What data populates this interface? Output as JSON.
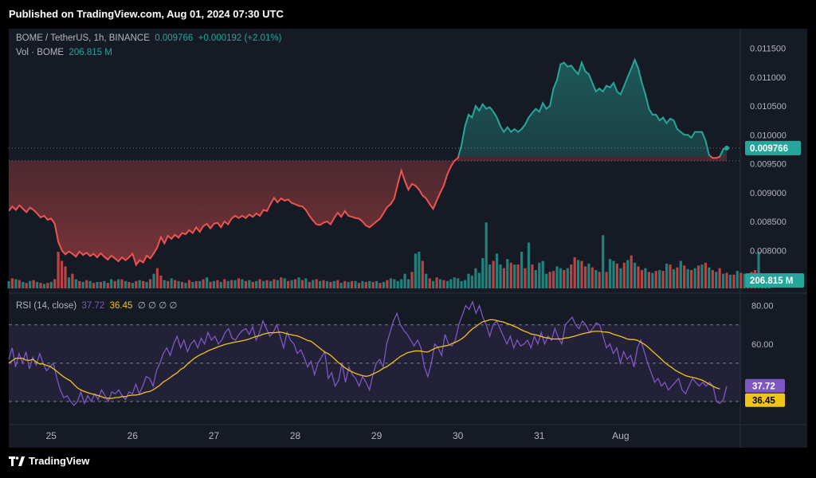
{
  "header": {
    "published": "Published on TradingView.com, Aug 01, 2024 07:30 UTC"
  },
  "legend": {
    "symbol": "BOME / TetherUS, 1h, BINANCE",
    "last": "0.009766",
    "change": "+0.000192 (+2.01%)",
    "vol_label": "Vol · BOME",
    "vol_value": "206.815 M",
    "rsi_label": "RSI (14, close)",
    "rsi_value": "37.72",
    "rsi_ma_value": "36.45",
    "rsi_extra": "∅ ∅ ∅ ∅"
  },
  "footer": {
    "brand": "TradingView"
  },
  "colors": {
    "up": "#26a69a",
    "down": "#ef5350",
    "rsi": "#7e57c2",
    "rsi_ma": "#f0c419",
    "panel_bg": "#161a25"
  },
  "chart_data": [
    {
      "type": "line",
      "title": "BOME / TetherUS, 1h, BINANCE",
      "baseline": 0.00955,
      "x_ticks": [
        "25",
        "26",
        "27",
        "28",
        "29",
        "30",
        "31",
        "Aug"
      ],
      "y_ticks": [
        "0.011500",
        "0.011000",
        "0.010500",
        "0.010000",
        "0.009500",
        "0.009000",
        "0.008500",
        "0.008000"
      ],
      "ylim": [
        0.0077,
        0.0117
      ],
      "last_price_label": "0.009766",
      "values": [
        0.00868,
        0.00876,
        0.0087,
        0.00878,
        0.00872,
        0.00866,
        0.00874,
        0.0087,
        0.00864,
        0.00857,
        0.0086,
        0.00853,
        0.00855,
        0.00846,
        0.00815,
        0.008,
        0.00793,
        0.00798,
        0.00794,
        0.00789,
        0.00798,
        0.00792,
        0.00796,
        0.0079,
        0.00794,
        0.00788,
        0.00795,
        0.00789,
        0.00784,
        0.00791,
        0.00786,
        0.00781,
        0.00788,
        0.00783,
        0.00788,
        0.00794,
        0.00775,
        0.00783,
        0.00779,
        0.00791,
        0.00786,
        0.00795,
        0.00805,
        0.00823,
        0.00812,
        0.00825,
        0.0082,
        0.00827,
        0.00822,
        0.0083,
        0.00828,
        0.00835,
        0.0083,
        0.0084,
        0.00832,
        0.00842,
        0.00846,
        0.00838,
        0.00846,
        0.00848,
        0.0084,
        0.0085,
        0.00845,
        0.00855,
        0.0086,
        0.00856,
        0.0086,
        0.00856,
        0.00862,
        0.00858,
        0.00864,
        0.0086,
        0.0087,
        0.00868,
        0.0088,
        0.00891,
        0.00883,
        0.0089,
        0.00886,
        0.00888,
        0.00882,
        0.0088,
        0.00877,
        0.00876,
        0.0087,
        0.0086,
        0.00852,
        0.00845,
        0.00844,
        0.00848,
        0.0085,
        0.00845,
        0.00856,
        0.00865,
        0.00858,
        0.00868,
        0.0086,
        0.00858,
        0.00856,
        0.00855,
        0.0085,
        0.00843,
        0.0084,
        0.00845,
        0.0085,
        0.00855,
        0.00865,
        0.00875,
        0.0088,
        0.0089,
        0.00915,
        0.00938,
        0.0092,
        0.00905,
        0.00915,
        0.00912,
        0.00905,
        0.00895,
        0.0089,
        0.0088,
        0.00872,
        0.00886,
        0.009,
        0.00912,
        0.00932,
        0.00945,
        0.00955,
        0.0096,
        0.00982,
        0.01015,
        0.01035,
        0.0103,
        0.0105,
        0.01042,
        0.01053,
        0.01045,
        0.01048,
        0.0104,
        0.0103,
        0.01015,
        0.01005,
        0.01013,
        0.01005,
        0.0101,
        0.01005,
        0.0101,
        0.01018,
        0.0103,
        0.01038,
        0.01045,
        0.0104,
        0.01055,
        0.01045,
        0.0105,
        0.0108,
        0.01095,
        0.01122,
        0.01125,
        0.01118,
        0.0112,
        0.01112,
        0.01105,
        0.01125,
        0.0111,
        0.01105,
        0.0109,
        0.01075,
        0.0108,
        0.01075,
        0.01085,
        0.01082,
        0.0109,
        0.01075,
        0.0107,
        0.01085,
        0.011,
        0.01115,
        0.0113,
        0.01115,
        0.0109,
        0.0107,
        0.01045,
        0.01035,
        0.01035,
        0.01025,
        0.0103,
        0.0102,
        0.01028,
        0.01025,
        0.0101,
        0.01005,
        0.01,
        0.01,
        0.00995,
        0.01005,
        0.01005,
        0.01005,
        0.0099,
        0.00965,
        0.0096,
        0.0096,
        0.00962,
        0.00975,
        0.00977
      ]
    },
    {
      "type": "bar",
      "title": "Vol · BOME",
      "last_value_label": "206.815 M",
      "values": [
        8,
        11,
        10,
        9,
        7,
        6,
        8,
        9,
        7,
        6,
        5,
        6,
        7,
        10,
        40,
        30,
        24,
        12,
        16,
        10,
        8,
        7,
        9,
        8,
        6,
        7,
        7,
        8,
        6,
        10,
        8,
        10,
        10,
        8,
        7,
        6,
        8,
        9,
        8,
        7,
        10,
        16,
        22,
        14,
        9,
        8,
        11,
        9,
        8,
        7,
        6,
        9,
        7,
        8,
        8,
        10,
        12,
        7,
        8,
        9,
        7,
        10,
        8,
        9,
        9,
        11,
        10,
        8,
        9,
        7,
        8,
        10,
        8,
        9,
        8,
        10,
        9,
        12,
        11,
        8,
        9,
        10,
        12,
        9,
        11,
        7,
        9,
        10,
        8,
        9,
        8,
        7,
        8,
        9,
        6,
        8,
        7,
        8,
        8,
        6,
        8,
        7,
        8,
        7,
        8,
        6,
        7,
        9,
        11,
        10,
        8,
        10,
        16,
        10,
        18,
        38,
        40,
        30,
        16,
        11,
        8,
        12,
        10,
        9,
        8,
        10,
        12,
        11,
        8,
        9,
        16,
        14,
        22,
        17,
        33,
        72,
        26,
        30,
        38,
        26,
        22,
        32,
        28,
        26,
        26,
        40,
        22,
        50,
        26,
        20,
        28,
        30,
        16,
        18,
        19,
        24,
        22,
        20,
        22,
        26,
        34,
        31,
        30,
        24,
        27,
        23,
        20,
        18,
        58,
        18,
        32,
        30,
        27,
        22,
        28,
        31,
        36,
        28,
        24,
        20,
        22,
        18,
        17,
        19,
        20,
        19,
        27,
        26,
        21,
        23,
        30,
        25,
        21,
        20,
        22,
        25,
        26,
        28,
        23,
        20,
        18,
        22,
        16,
        17,
        15,
        15,
        19,
        17,
        16,
        14,
        18,
        20,
        40,
        16,
        15,
        10
      ],
      "up": [
        true,
        false,
        true,
        false,
        true,
        false,
        true,
        false,
        true,
        false,
        true,
        false,
        true,
        false,
        false,
        false,
        false,
        true,
        false,
        true,
        false,
        true,
        false,
        true,
        false,
        true,
        false,
        true,
        false,
        true,
        false,
        true,
        false,
        true,
        false,
        true,
        false,
        true,
        false,
        true,
        false,
        true,
        false,
        false,
        true,
        false,
        true,
        false,
        true,
        false,
        true,
        false,
        true,
        false,
        true,
        false,
        true,
        false,
        true,
        false,
        true,
        false,
        true,
        false,
        true,
        false,
        true,
        false,
        true,
        false,
        true,
        false,
        true,
        false,
        true,
        false,
        true,
        false,
        true,
        false,
        true,
        false,
        true,
        false,
        true,
        false,
        true,
        false,
        true,
        false,
        true,
        false,
        true,
        false,
        true,
        false,
        true,
        false,
        true,
        false,
        true,
        false,
        true,
        false,
        true,
        false,
        true,
        false,
        true,
        true,
        true,
        true,
        true,
        true,
        false,
        true,
        true,
        false,
        true,
        false,
        true,
        false,
        true,
        false,
        true,
        true,
        true,
        true,
        true,
        true,
        true,
        true,
        true,
        true,
        true,
        true,
        true,
        false,
        true,
        true,
        false,
        true,
        false,
        true,
        false,
        true,
        false,
        true,
        false,
        true,
        true,
        true,
        true,
        false,
        false,
        true,
        true,
        false,
        true,
        false,
        false,
        true,
        false,
        false,
        true,
        false,
        true,
        false,
        true,
        false,
        true,
        true,
        false,
        true,
        false,
        true,
        false,
        true,
        false,
        false,
        true,
        false,
        true,
        false,
        true,
        false,
        true,
        false,
        true,
        false,
        true,
        false,
        true,
        false,
        true,
        false,
        true,
        false,
        true,
        false,
        true,
        false,
        true,
        false,
        true,
        false,
        true,
        false,
        true,
        false,
        false,
        false,
        true,
        false,
        true,
        true,
        true,
        true,
        true,
        false,
        true,
        true
      ],
      "ylim": [
        0,
        80
      ]
    },
    {
      "type": "line",
      "title": "RSI (14, close)",
      "y_ticks": [
        "80.00",
        "60.00"
      ],
      "ylim": [
        20,
        84
      ],
      "bands": [
        70,
        50,
        30
      ],
      "series": [
        {
          "name": "RSI",
          "last_label": "37.72",
          "values": [
            52,
            58,
            48,
            55,
            50,
            56,
            47,
            53,
            49,
            55,
            50,
            46,
            48,
            50,
            42,
            36,
            32,
            33,
            30,
            28,
            30,
            35,
            29,
            33,
            30,
            34,
            31,
            36,
            33,
            30,
            35,
            34,
            36,
            33,
            31,
            35,
            34,
            39,
            34,
            38,
            43,
            42,
            38,
            46,
            50,
            55,
            58,
            54,
            60,
            64,
            58,
            62,
            56,
            60,
            62,
            58,
            63,
            60,
            66,
            62,
            64,
            60,
            62,
            66,
            68,
            63,
            62,
            65,
            67,
            68,
            65,
            69,
            62,
            66,
            72,
            68,
            64,
            66,
            70,
            64,
            58,
            66,
            62,
            60,
            55,
            57,
            53,
            48,
            51,
            44,
            50,
            53,
            56,
            42,
            45,
            38,
            41,
            50,
            40,
            48,
            44,
            42,
            38,
            43,
            40,
            36,
            44,
            50,
            52,
            48,
            60,
            66,
            72,
            76,
            70,
            67,
            65,
            62,
            59,
            62,
            58,
            48,
            43,
            50,
            60,
            58,
            54,
            65,
            60,
            59,
            62,
            70,
            75,
            80,
            78,
            82,
            76,
            80,
            74,
            70,
            64,
            70,
            72,
            68,
            64,
            60,
            64,
            58,
            62,
            59,
            60,
            62,
            58,
            64,
            60,
            66,
            60,
            64,
            62,
            68,
            63,
            60,
            70,
            72,
            74,
            70,
            68,
            72,
            70,
            66,
            68,
            71,
            70,
            64,
            58,
            60,
            55,
            58,
            50,
            56,
            52,
            54,
            48,
            58,
            62,
            56,
            50,
            45,
            40,
            42,
            38,
            40,
            36,
            38,
            40,
            42,
            36,
            34,
            38,
            42,
            40,
            38,
            40,
            38,
            40,
            38,
            30,
            29,
            31,
            38
          ]
        },
        {
          "name": "MA",
          "last_label": "36.45",
          "values": [
            50.0,
            51.2,
            52.5,
            52.6,
            52.5,
            51.6,
            51.4,
            52.0,
            50.6,
            49.6,
            49.6,
            48.8,
            48.3,
            47.1,
            45.7,
            44.2,
            42.8,
            41.7,
            40.7,
            38.8,
            37.1,
            36.0,
            35.2,
            34.6,
            34.0,
            33.6,
            33.1,
            32.5,
            31.8,
            31.7,
            31.6,
            32.0,
            32.1,
            32.6,
            32.5,
            33.1,
            33.3,
            33.4,
            33.6,
            34.3,
            34.9,
            35.2,
            36.1,
            37.3,
            38.5,
            40.2,
            41.2,
            42.5,
            43.8,
            44.9,
            46.7,
            47.7,
            49.5,
            51.0,
            52.5,
            53.6,
            54.6,
            55.4,
            56.4,
            57.1,
            57.8,
            58.6,
            59.2,
            59.8,
            60.2,
            60.6,
            61.0,
            61.3,
            61.7,
            62.1,
            62.6,
            63.3,
            63.9,
            64.3,
            65.1,
            65.5,
            65.9,
            65.9,
            66.0,
            66.2,
            65.8,
            65.3,
            64.9,
            64.5,
            64.2,
            63.5,
            62.7,
            61.8,
            61.4,
            60.0,
            58.6,
            57.2,
            55.7,
            54.9,
            53.6,
            51.9,
            50.2,
            48.9,
            47.4,
            46.3,
            45.4,
            44.6,
            44.0,
            43.5,
            43.1,
            43.5,
            44.3,
            45.1,
            46.1,
            47.3,
            48.1,
            49.4,
            50.7,
            52.1,
            53.5,
            54.4,
            55.4,
            55.8,
            56.3,
            56.4,
            56.3,
            55.9,
            55.8,
            56.8,
            57.6,
            58.3,
            58.6,
            59.0,
            59.3,
            60.2,
            60.9,
            61.8,
            62.9,
            64.4,
            66.3,
            67.9,
            69.1,
            70.5,
            71.6,
            72.0,
            72.6,
            72.6,
            72.3,
            71.8,
            71.4,
            70.7,
            70.1,
            69.3,
            68.6,
            67.6,
            66.7,
            66.1,
            65.2,
            64.9,
            64.5,
            63.9,
            63.4,
            63.1,
            62.6,
            62.6,
            62.6,
            62.6,
            63.1,
            63.3,
            63.7,
            64.2,
            64.8,
            65.3,
            65.7,
            66.0,
            66.5,
            66.6,
            66.6,
            66.3,
            66.2,
            65.9,
            65.1,
            64.6,
            64.0,
            63.4,
            62.6,
            62.3,
            62.3,
            61.9,
            60.9,
            59.9,
            58.5,
            56.8,
            55.2,
            53.6,
            52.0,
            50.2,
            48.9,
            47.7,
            46.3,
            45.3,
            44.4,
            43.5,
            43.0,
            42.6,
            42.2,
            41.6,
            41.0,
            40.0,
            38.9,
            37.9,
            37.1,
            36.5
          ]
        }
      ]
    }
  ]
}
